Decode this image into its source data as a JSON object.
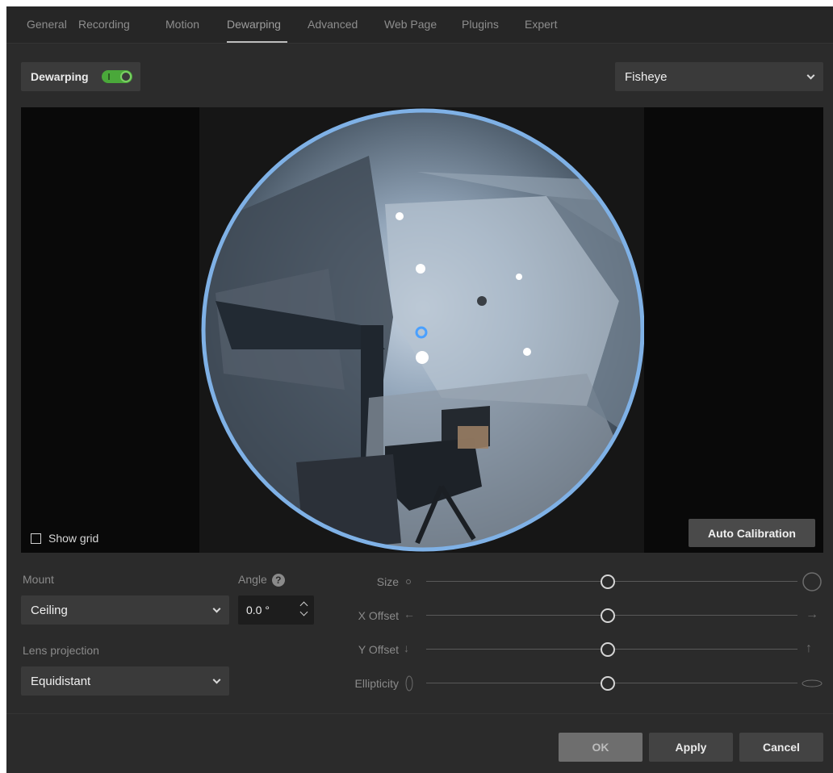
{
  "tabs": [
    {
      "label": "General"
    },
    {
      "label": "Recording"
    },
    {
      "label": "Motion"
    },
    {
      "label": "Dewarping"
    },
    {
      "label": "Advanced"
    },
    {
      "label": "Web Page"
    },
    {
      "label": "Plugins"
    },
    {
      "label": "Expert"
    }
  ],
  "active_tab": "Dewarping",
  "dewarping": {
    "label": "Dewarping",
    "enabled": true
  },
  "view_mode": {
    "selected": "Fisheye"
  },
  "preview": {
    "show_grid_label": "Show grid",
    "show_grid_checked": false,
    "auto_calibration_label": "Auto Calibration"
  },
  "mount": {
    "label": "Mount",
    "selected": "Ceiling"
  },
  "angle": {
    "label": "Angle",
    "value": "0.0 °"
  },
  "lens": {
    "label": "Lens projection",
    "selected": "Equidistant"
  },
  "sliders": [
    {
      "label": "Size",
      "value": 0.49
    },
    {
      "label": "X Offset",
      "value": 0.49
    },
    {
      "label": "Y Offset",
      "value": 0.49
    },
    {
      "label": "Ellipticity",
      "value": 0.49
    }
  ],
  "buttons": {
    "ok": "OK",
    "apply": "Apply",
    "cancel": "Cancel"
  },
  "colors": {
    "accent_green": "#4aa83a",
    "fisheye_ring": "#7fb1e6",
    "background": "#2b2b2b"
  }
}
